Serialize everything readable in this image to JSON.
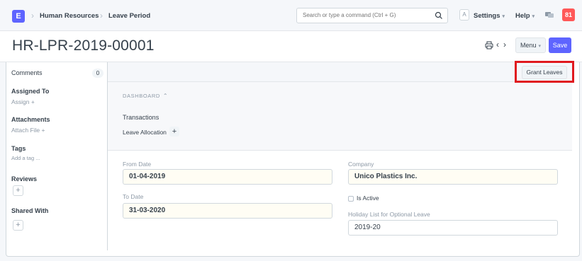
{
  "navbar": {
    "logo": "E",
    "breadcrumbs": [
      "Human Resources",
      "Leave Period"
    ],
    "search_placeholder": "Search or type a command (Ctrl + G)",
    "avatar": "A",
    "settings_label": "Settings",
    "help_label": "Help",
    "notification_count": "81"
  },
  "page": {
    "title": "HR-LPR-2019-00001",
    "menu_label": "Menu",
    "save_label": "Save"
  },
  "sidebar": {
    "comments_label": "Comments",
    "comments_count": "0",
    "assigned_to_label": "Assigned To",
    "assign_label": "Assign +",
    "attachments_label": "Attachments",
    "attach_file_label": "Attach File +",
    "tags_label": "Tags",
    "add_tag_label": "Add a tag ...",
    "reviews_label": "Reviews",
    "shared_with_label": "Shared With"
  },
  "toolbar": {
    "grant_leaves_label": "Grant Leaves"
  },
  "dashboard": {
    "title": "DASHBOARD",
    "transactions_label": "Transactions",
    "leave_allocation_label": "Leave Allocation"
  },
  "form": {
    "from_date_label": "From Date",
    "from_date_value": "01-04-2019",
    "to_date_label": "To Date",
    "to_date_value": "31-03-2020",
    "company_label": "Company",
    "company_value": "Unico Plastics Inc.",
    "is_active_label": "Is Active",
    "holiday_list_label": "Holiday List for Optional Leave",
    "holiday_list_value": "2019-20"
  },
  "colors": {
    "accent": "#5e64ff",
    "badge": "#ff5858",
    "highlight": "#e0191f"
  }
}
